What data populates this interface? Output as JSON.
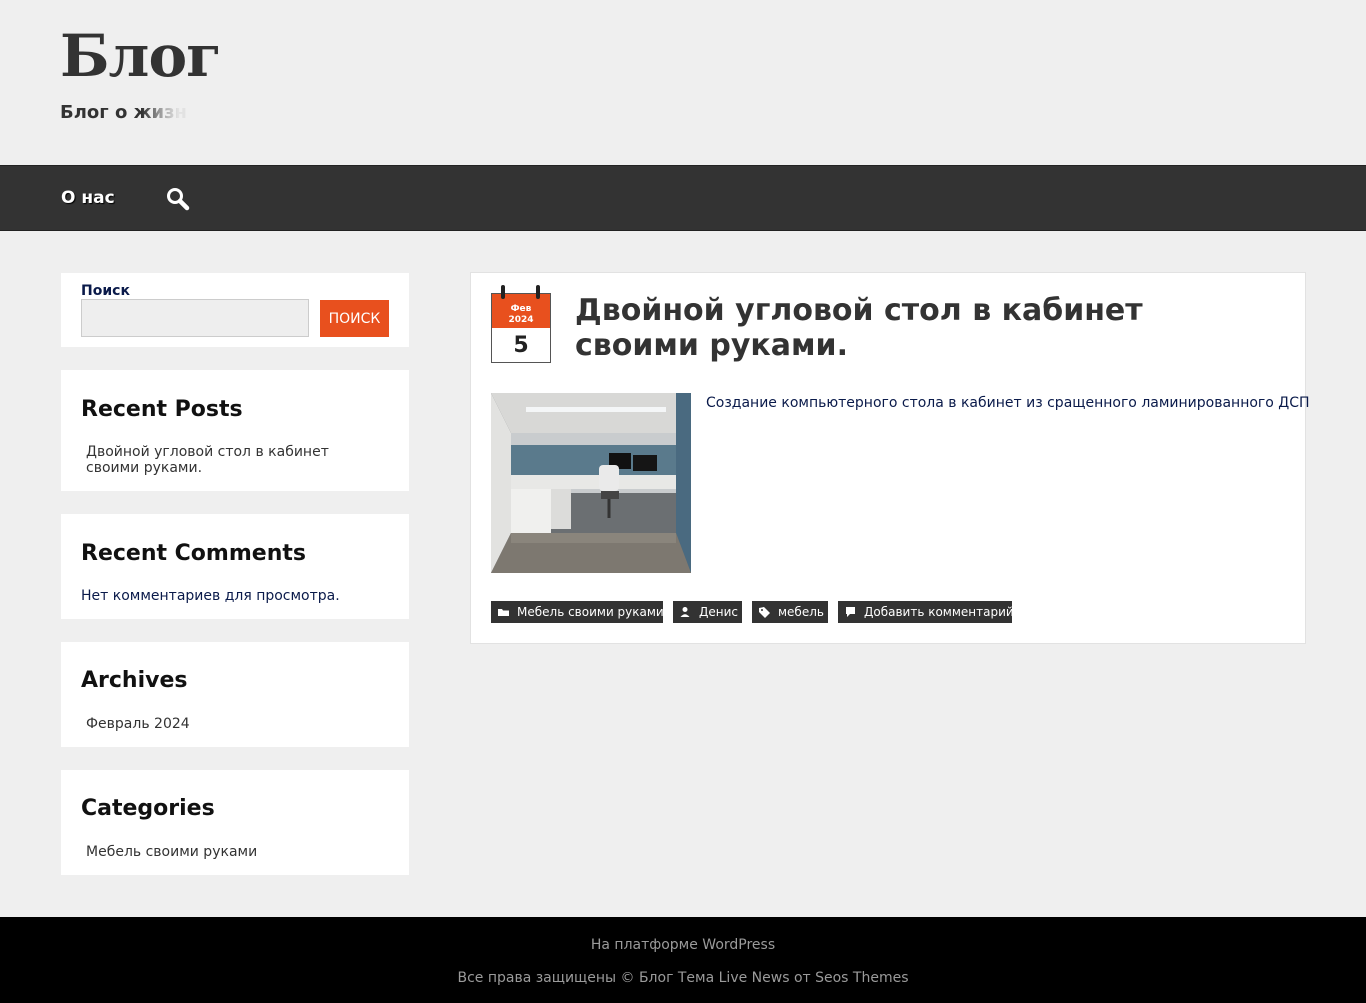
{
  "header": {
    "site_title": "Блог",
    "tagline": "Блог о жизн"
  },
  "nav": {
    "items": [
      {
        "label": "О нас"
      }
    ],
    "search_icon": "search-icon"
  },
  "sidebar": {
    "search": {
      "label": "Поиск",
      "placeholder": "",
      "button_label": "ПОИСК"
    },
    "recent_posts": {
      "title": "Recent Posts",
      "items": [
        "Двойной угловой стол в кабинет своими руками."
      ]
    },
    "recent_comments": {
      "title": "Recent Comments",
      "empty_text": "Нет комментариев для просмотра."
    },
    "archives": {
      "title": "Archives",
      "items": [
        "Февраль 2024"
      ]
    },
    "categories": {
      "title": "Categories",
      "items": [
        "Мебель своими руками"
      ]
    }
  },
  "post": {
    "date": {
      "month": "Фев",
      "year": "2024",
      "day": "5"
    },
    "title": "Двойной угловой стол в кабинет своими руками.",
    "excerpt": "Создание компьютерного стола в кабинет из сращенного ламинированного ДСП",
    "meta": {
      "category": "Мебель своими руками",
      "author": "Денис",
      "tag": "мебель",
      "comment_link": "Добавить комментарий"
    }
  },
  "footer": {
    "powered": "На платформе WordPress",
    "copyright": "Все права защищены © Блог Тема Live News от Seos Themes"
  },
  "colors": {
    "accent": "#e8501e",
    "nav_bg": "#333333",
    "footer_bg": "#000000",
    "page_bg": "#efefef"
  }
}
